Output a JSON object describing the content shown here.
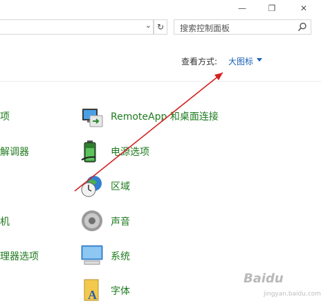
{
  "window": {
    "controls": [
      "—",
      "❐",
      "✕"
    ]
  },
  "search": {
    "placeholder": "搜索控制面板"
  },
  "view_by": {
    "label": "查看方式:",
    "value": "大图标"
  },
  "left_column": [
    "项",
    "解调器",
    "",
    "机",
    "理器选项"
  ],
  "right_column": [
    {
      "label": "RemoteApp 和桌面连接",
      "icon": "remoteapp-icon"
    },
    {
      "label": "电源选项",
      "icon": "battery-icon"
    },
    {
      "label": "区域",
      "icon": "region-clock-icon"
    },
    {
      "label": "声音",
      "icon": "speaker-icon"
    },
    {
      "label": "系统",
      "icon": "monitor-icon"
    },
    {
      "label": "字体",
      "icon": "font-icon"
    }
  ],
  "watermark": {
    "text": "Baidu",
    "sub": "jingyan.baidu.com"
  },
  "colors": {
    "link_green": "#1e7a1e",
    "link_blue": "#1a5fb4",
    "arrow_red": "#d42020"
  }
}
